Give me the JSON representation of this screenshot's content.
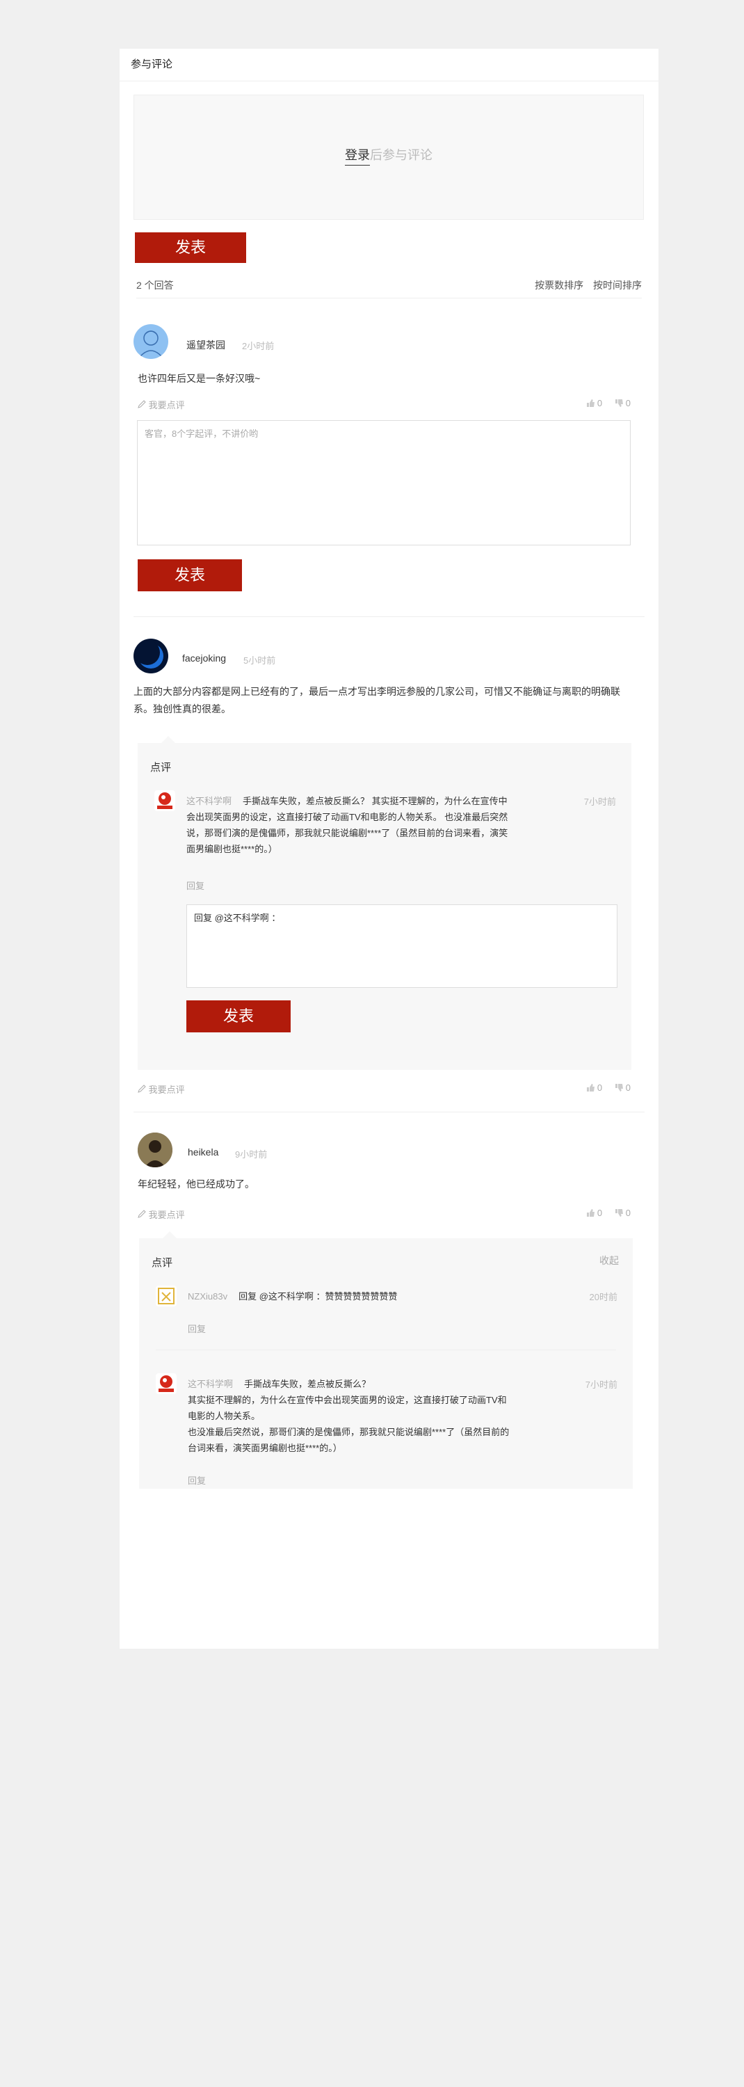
{
  "section_title": "参与评论",
  "login_prompt": {
    "link": "登录",
    "rest": "后参与评论"
  },
  "publish_label": "发表",
  "answer_count": "2 个回答",
  "sort": {
    "by_count": "按票数排序",
    "by_time": "按时间排序"
  },
  "write_comment": "我要点评",
  "comment_placeholder": "客官，8个字起评，不讲价哟",
  "comments_title": "点评",
  "reply_label": "回复",
  "collapse_label": "收起",
  "answers": [
    {
      "user": "遥望茶园",
      "time": "2小时前",
      "text": "也许四年后又是一条好汉哦~",
      "up": "0",
      "down": "0"
    },
    {
      "user": "facejoking",
      "time": "5小时前",
      "text_line1": "上面的大部分内容都是网上已经有的了，最后一点才写出李明远参股的几家公司，可惜又不能确证与离职的明确联",
      "text_line2": "系。独创性真的很差。",
      "up": "0",
      "down": "0",
      "reply": {
        "user": "这不科学啊",
        "time": "7小时前",
        "line1": "手撕战车失败，差点被反撕么？ 其实挺不理解的，为什么在宣传中",
        "line2": "会出现笑面男的设定，这直接打破了动画TV和电影的人物关系。 也没准最后突然",
        "line3": "说，那哥们演的是傀儡师，那我就只能说编剧****了（虽然目前的台词来看，演笑",
        "line4": "面男编剧也挺****的。）",
        "reply_input": "回复 @这不科学啊 ："
      }
    },
    {
      "user": "heikela",
      "time": "9小时前",
      "text": "年纪轻轻，他已经成功了。",
      "up": "0",
      "down": "0",
      "replies": [
        {
          "user": "NZXiu83v",
          "time": "20时前",
          "line1": "回复 @这不科学啊 ：赞赞赞赞赞赞赞赞"
        },
        {
          "user": "这不科学啊",
          "time": "7小时前",
          "line1": "手撕战车失败，差点被反撕么？",
          "line2": "其实挺不理解的，为什么在宣传中会出现笑面男的设定，这直接打破了动画TV和",
          "line3": "电影的人物关系。",
          "line4": "也没准最后突然说，那哥们演的是傀儡师，那我就只能说编剧****了（虽然目前的",
          "line5": "台词来看，演笑面男编剧也挺****的。）"
        }
      ]
    }
  ],
  "colors": {
    "accent": "#b11b0b",
    "muted": "#aaaaaa",
    "panel_bg": "#f7f7f7"
  }
}
